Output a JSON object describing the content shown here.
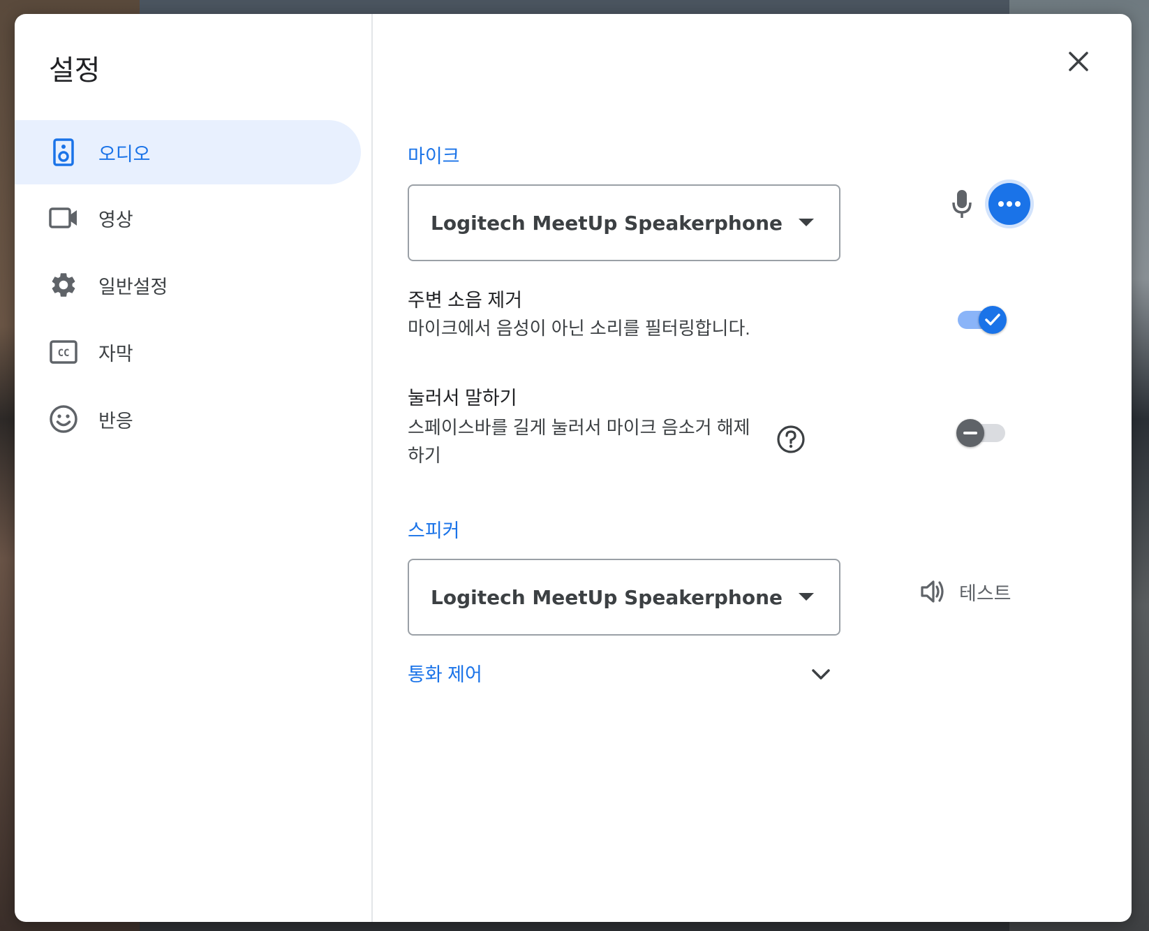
{
  "dialog": {
    "title": "설정",
    "close_icon": "close-icon"
  },
  "sidebar": {
    "items": [
      {
        "label": "오디오",
        "icon": "speaker-icon",
        "active": true
      },
      {
        "label": "영상",
        "icon": "videocam-icon",
        "active": false
      },
      {
        "label": "일반설정",
        "icon": "gear-icon",
        "active": false
      },
      {
        "label": "자막",
        "icon": "closed-caption-icon",
        "active": false
      },
      {
        "label": "반응",
        "icon": "smiley-icon",
        "active": false
      }
    ]
  },
  "audio": {
    "mic_section_label": "마이크",
    "mic_selected": "Logitech MeetUp Speakerphone",
    "noise_cancel": {
      "title": "주변 소음 제거",
      "description": "마이크에서 음성이 아닌 소리를 필터링합니다.",
      "enabled": true
    },
    "push_to_talk": {
      "title": "눌러서 말하기",
      "description_line1": "스페이스바를 길게 눌러서 마이크 음소거 해제",
      "description_line2": "하기",
      "enabled": false
    },
    "speaker_section_label": "스피커",
    "speaker_selected": "Logitech MeetUp Speakerphone",
    "test_label": "테스트",
    "call_control_label": "통화 제어"
  },
  "colors": {
    "accent": "#1a73e8",
    "active_nav_bg": "#e8f0fe",
    "text_primary": "#202124",
    "text_secondary": "#3c4043"
  }
}
